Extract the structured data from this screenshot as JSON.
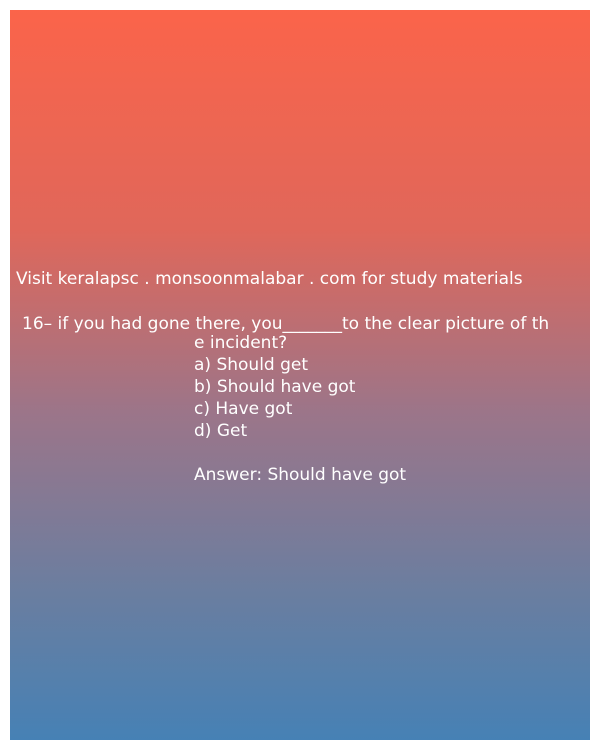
{
  "site_text": "Visit keralapsc . monsoonmalabar . com for study materials",
  "question": {
    "line1": "16– if you had gone there, you_______to the clear picture of th",
    "line2": "e incident?"
  },
  "options": [
    "a) Should get",
    "b) Should have got",
    "c) Have got",
    "d) Get"
  ],
  "answer_text": "Answer: Should have got"
}
